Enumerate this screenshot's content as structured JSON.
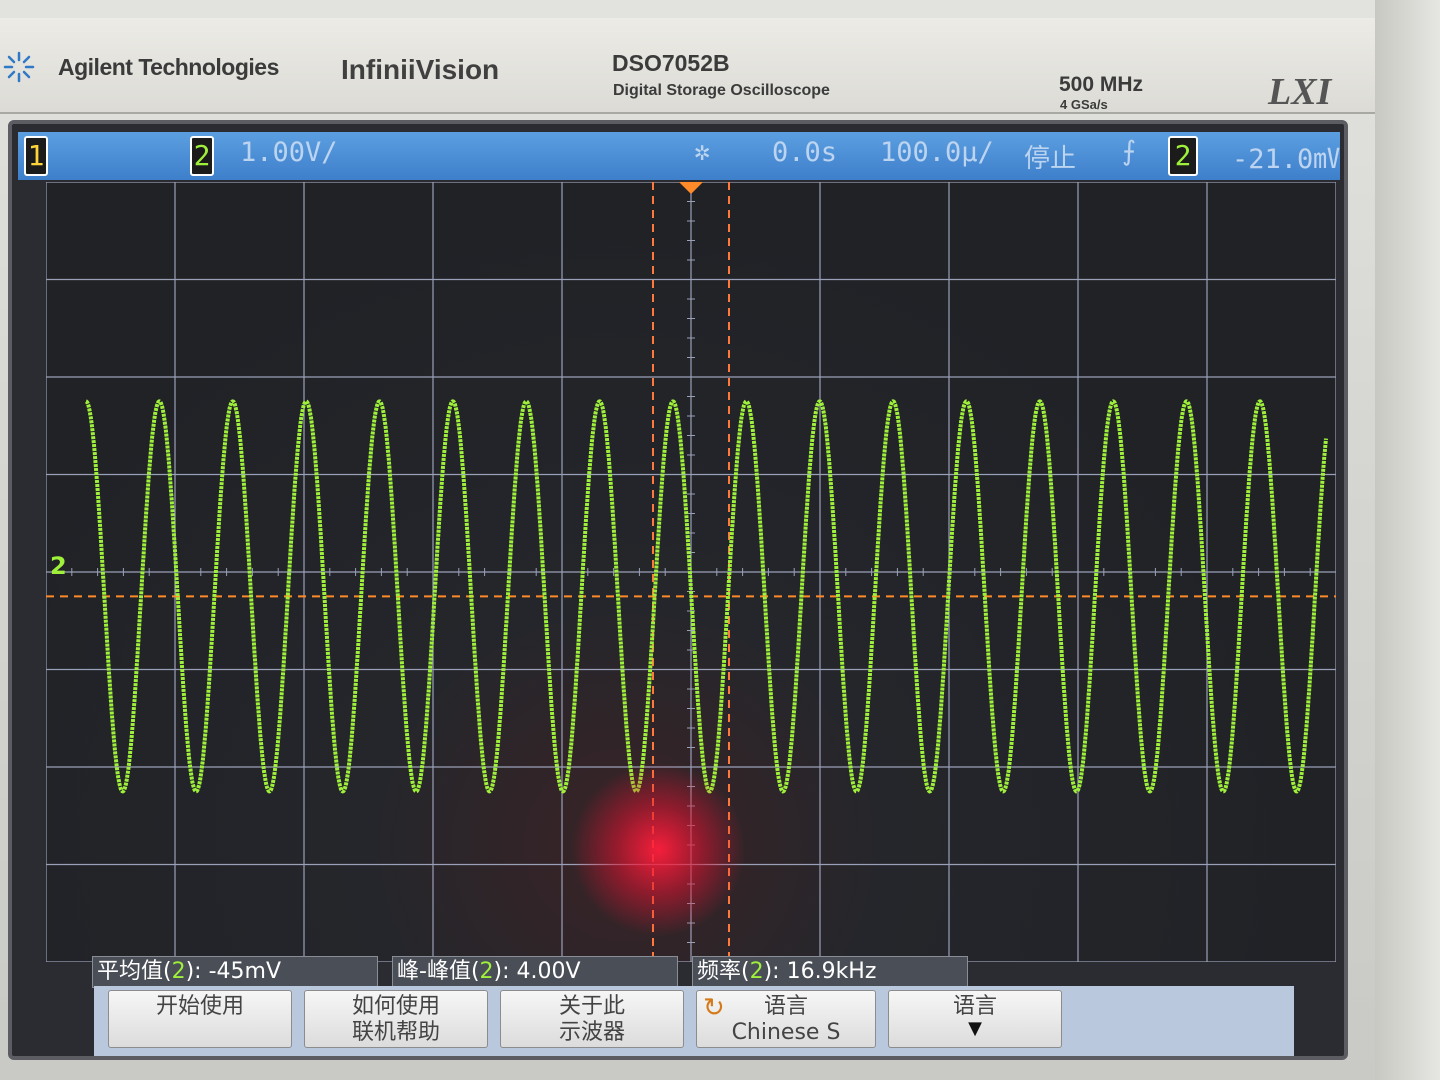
{
  "header": {
    "brand": "Agilent Technologies",
    "series": "InfiniiVision",
    "model": "DSO7052B",
    "model_description": "Digital Storage Oscilloscope",
    "bandwidth": "500 MHz",
    "sample_rate": "4 GSa/s",
    "lxi": "LXI"
  },
  "status_bar": {
    "ch1_badge": "1",
    "ch2_badge": "2",
    "volts_per_div": "1.00V/",
    "time_offset": "0.0s",
    "time_per_div": "100.0µ/",
    "run_state": "停止",
    "trigger_channel": "2",
    "trigger_level": "-21.0㎷"
  },
  "ground_marker": "2",
  "measurements": {
    "avg_label": "平均值(",
    "avg_ch": "2",
    "avg_value": "): -45mV",
    "pp_label": "峰-峰值(",
    "pp_ch": "2",
    "pp_value": "): 4.00V",
    "freq_label": "频率(",
    "freq_ch": "2",
    "freq_value": "): 16.9kHz"
  },
  "softkeys": {
    "start_line1": "开始使用",
    "howto_line1": "如何使用",
    "howto_line2": "联机帮助",
    "about_line1": "关于此",
    "about_line2": "示波器",
    "lang_line1": "语言",
    "lang_line2": "Chinese S",
    "lang_menu_line1": "语言"
  },
  "colors": {
    "ch1": "#ffd43a",
    "ch2": "#9ff03a",
    "trigger_line": "#ff8a2a",
    "cursor": "#ff7a3a",
    "grid": "#9aa0b8"
  },
  "icons": {
    "brand": "agilent-spark-icon",
    "trigger": "trigger-spark-icon",
    "trigger_edge": "rising-edge-icon",
    "cycle": "cycle-arrow-icon",
    "down": "down-arrow-icon"
  },
  "chart_data": {
    "type": "line",
    "series": [
      {
        "name": "",
        "x": [
          -500,
          500
        ],
        "amplitude_div": 2.0,
        "offset_div": -0.25,
        "cycles_visible": 16.9
      }
    ],
    "xlim_div": [
      -5,
      5
    ],
    "ylim_div": [
      -4,
      4
    ],
    "grid": true
  }
}
